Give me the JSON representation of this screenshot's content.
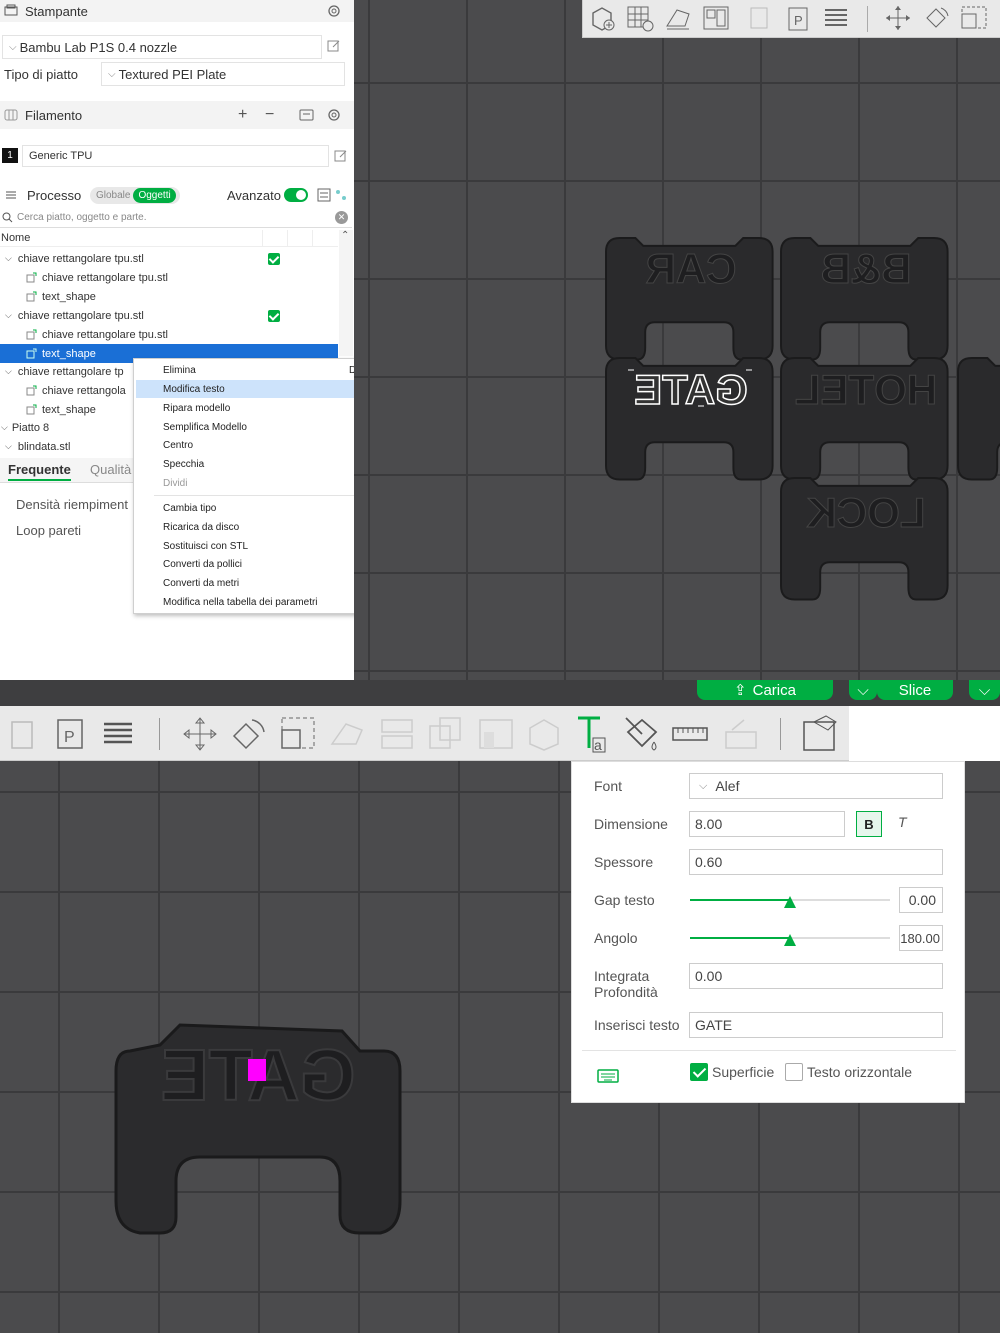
{
  "printer": {
    "section_label": "Stampante",
    "printer_name": "Bambu Lab P1S 0.4 nozzle",
    "plate_type_label": "Tipo di piatto",
    "plate_type_value": "Textured PEI Plate"
  },
  "filament": {
    "section_label": "Filamento",
    "slot_number": "1",
    "filament_name": "Generic TPU"
  },
  "process": {
    "section_label": "Processo",
    "toggle_global": "Globale",
    "toggle_objects": "Oggetti",
    "advanced_label": "Avanzato",
    "search_placeholder": "Cerca piatto, oggetto e parte."
  },
  "object_tree": {
    "column_name": "Nome",
    "rows": [
      {
        "label": "chiave rettangolare tpu.stl"
      },
      {
        "label": "chiave rettangolare tpu.stl"
      },
      {
        "label": "text_shape"
      },
      {
        "label": "chiave rettangolare tpu.stl"
      },
      {
        "label": "chiave rettangolare tpu.stl"
      },
      {
        "label": "text_shape"
      },
      {
        "label": "chiave rettangolare tp"
      },
      {
        "label": "chiave rettangola"
      },
      {
        "label": "text_shape"
      },
      {
        "label": "Piatto 8"
      },
      {
        "label": "blindata.stl"
      }
    ]
  },
  "settings_tabs": {
    "frequent": "Frequente",
    "quality": "Qualità"
  },
  "settings_items": {
    "infill_density": "Densità riempiment",
    "wall_loops": "Loop pareti"
  },
  "context_menu": {
    "items": [
      {
        "label": "Elimina",
        "shortcut": "Del"
      },
      {
        "label": "Modifica testo"
      },
      {
        "label": "Ripara modello"
      },
      {
        "label": "Semplifica Modello"
      },
      {
        "label": "Centro"
      },
      {
        "label": "Specchia"
      },
      {
        "label": "Dividi"
      },
      {
        "label": "Cambia tipo"
      },
      {
        "label": "Ricarica da disco"
      },
      {
        "label": "Sostituisci con STL"
      },
      {
        "label": "Converti da pollici"
      },
      {
        "label": "Converti da metri"
      },
      {
        "label": "Modifica nella tabella dei parametri"
      }
    ]
  },
  "plate_models": {
    "labels": [
      "CAR",
      "B&B",
      "GATE",
      "HOTEL",
      "LOCK",
      "GATE"
    ]
  },
  "bottom_bar": {
    "load_label": "Carica",
    "slice_label": "Slice"
  },
  "text_tool": {
    "font_label": "Font",
    "font_value": "Alef",
    "size_label": "Dimensione",
    "size_value": "8.00",
    "bold_label": "B",
    "italic_label": "T",
    "thickness_label": "Spessore",
    "thickness_value": "0.60",
    "gap_label": "Gap testo",
    "gap_value": "0.00",
    "angle_label": "Angolo",
    "angle_value": "180.00",
    "embedded_depth_label_1": "Integrata",
    "embedded_depth_label_2": "Profondità",
    "embedded_depth_value": "0.00",
    "input_text_label": "Inserisci testo",
    "input_text_value": "GATE",
    "surface_label": "Superficie",
    "horizontal_label": "Testo orizzontale"
  },
  "colors": {
    "accent": "#00ae42",
    "selection": "#1a6fd6",
    "highlight": "#cde3fb",
    "viewport": "#4b4b4d",
    "model": "#2a2a2c"
  }
}
